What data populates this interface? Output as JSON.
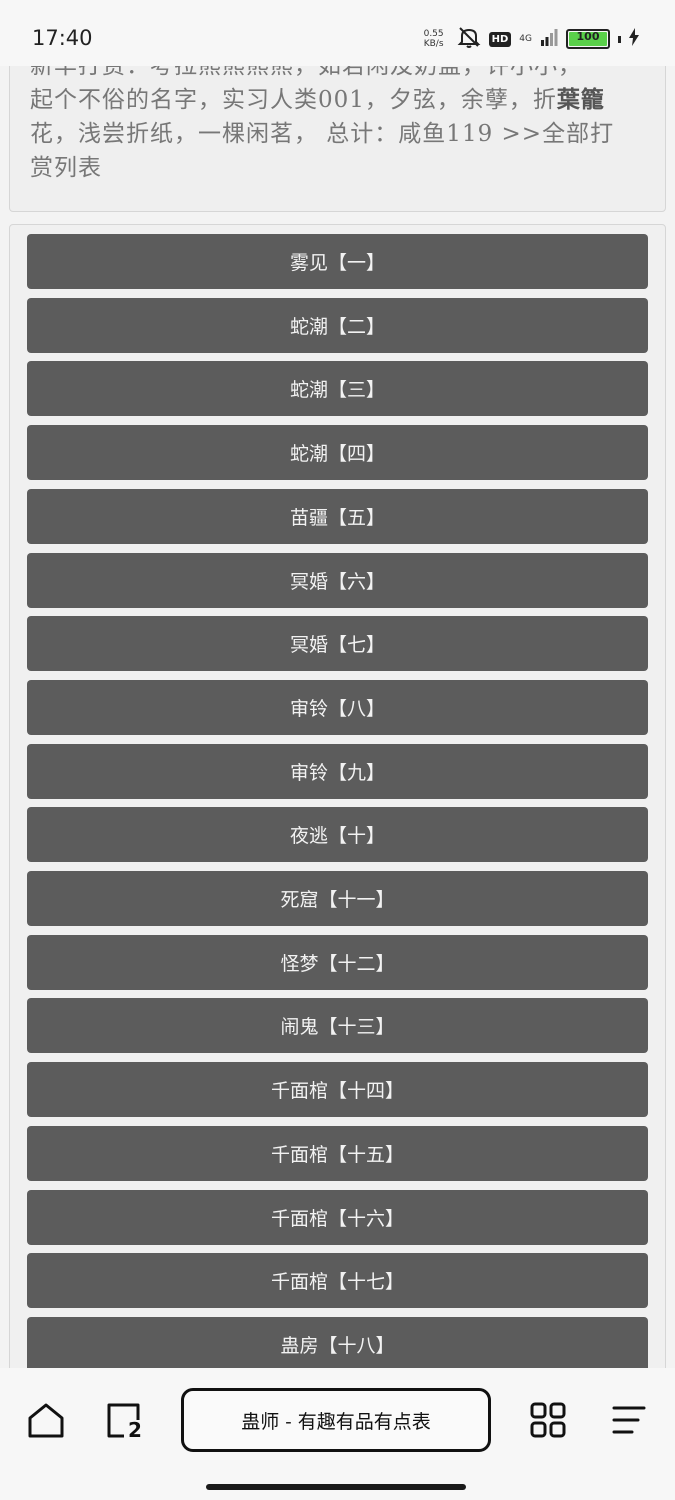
{
  "status_bar": {
    "time": "17:40",
    "net_speed_value": "0.55",
    "net_speed_unit": "KB/s",
    "hd_label": "HD",
    "network": "4G",
    "battery": "100",
    "battery_level": 1.0
  },
  "intro": {
    "line1": "新华打赏：考拉熊熊熊熊，如若闲及奶盖，许小小，",
    "line2a": "起个不俗的名字，实习人类001，夕弦，余孽，折",
    "line2_highlight": "葉籠",
    "line3": "花，浅尝折纸，一棵闲茗，  总计：咸鱼119  >>全部打",
    "line4": "赏列表"
  },
  "chapters": [
    {
      "label": "雾见【一】"
    },
    {
      "label": "蛇潮【二】"
    },
    {
      "label": "蛇潮【三】"
    },
    {
      "label": "蛇潮【四】"
    },
    {
      "label": "苗疆【五】"
    },
    {
      "label": "冥婚【六】"
    },
    {
      "label": "冥婚【七】"
    },
    {
      "label": "审铃【八】"
    },
    {
      "label": "审铃【九】"
    },
    {
      "label": "夜逃【十】"
    },
    {
      "label": "死窟【十一】"
    },
    {
      "label": "怪梦【十二】"
    },
    {
      "label": "闹鬼【十三】"
    },
    {
      "label": "千面棺【十四】"
    },
    {
      "label": "千面棺【十五】"
    },
    {
      "label": "千面棺【十六】"
    },
    {
      "label": "千面棺【十七】"
    },
    {
      "label": "蛊房【十八】"
    }
  ],
  "bottom_nav": {
    "tab_count": "2",
    "page_title": "蛊师 - 有趣有品有点表"
  },
  "colors": {
    "chapter_bg": "#5c5c5c",
    "battery_green": "#5ad04a"
  }
}
